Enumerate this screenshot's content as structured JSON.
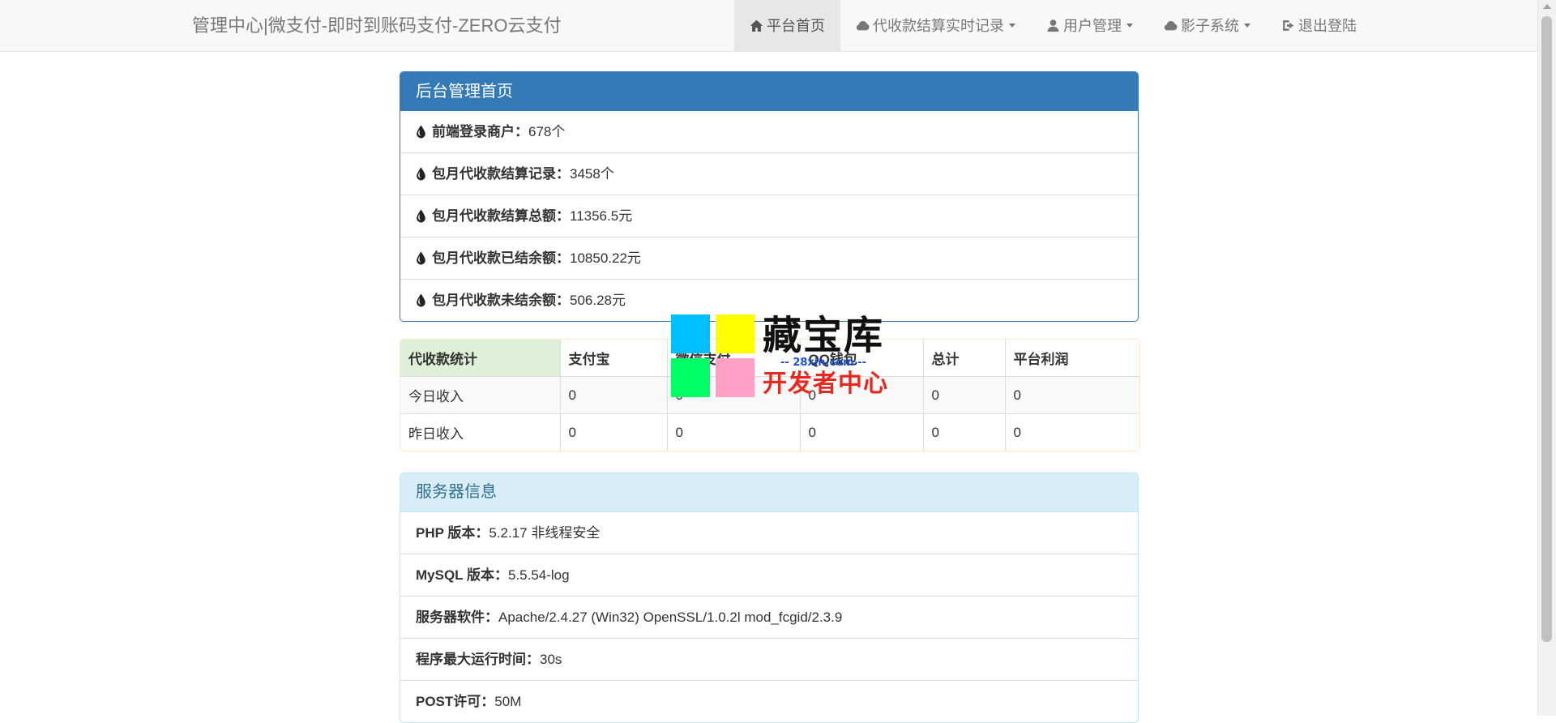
{
  "navbar": {
    "brand": "管理中心|微支付-即时到账码支付-ZERO云支付",
    "items": [
      {
        "label": "平台首页",
        "icon": "home-icon",
        "active": true
      },
      {
        "label": "代收款结算实时记录",
        "icon": "cloud-icon",
        "dropdown": true
      },
      {
        "label": "用户管理",
        "icon": "user-icon",
        "dropdown": true
      },
      {
        "label": "影子系统",
        "icon": "cloud-icon",
        "dropdown": true
      },
      {
        "label": "退出登陆",
        "icon": "logout-icon"
      }
    ]
  },
  "admin_panel": {
    "title": "后台管理首页",
    "items": [
      {
        "label": "前端登录商户：",
        "value": "678个"
      },
      {
        "label": "包月代收款结算记录：",
        "value": "3458个"
      },
      {
        "label": "包月代收款结算总额：",
        "value": "11356.5元"
      },
      {
        "label": "包月代收款已结余额：",
        "value": "10850.22元"
      },
      {
        "label": "包月代收款未结余额：",
        "value": "506.28元"
      }
    ]
  },
  "stats_table": {
    "headers": [
      "代收款统计",
      "支付宝",
      "微信支付",
      "QQ钱包",
      "总计",
      "平台利润"
    ],
    "rows": [
      [
        "今日收入",
        "0",
        "0",
        "0",
        "0",
        "0"
      ],
      [
        "昨日收入",
        "0",
        "0",
        "0",
        "0",
        "0"
      ]
    ]
  },
  "server_panel": {
    "title": "服务器信息",
    "items": [
      {
        "label": "PHP 版本：",
        "value": "5.2.17 非线程安全"
      },
      {
        "label": "MySQL 版本：",
        "value": "5.5.54-log"
      },
      {
        "label": "服务器软件：",
        "value": "Apache/2.4.27 (Win32) OpenSSL/1.0.2l mod_fcgid/2.3.9"
      },
      {
        "label": "程序最大运行时间：",
        "value": "30s"
      },
      {
        "label": "POST许可：",
        "value": "50M"
      }
    ]
  },
  "watermark": {
    "title": "藏宝库",
    "url": "-- 28xin.com --",
    "subtitle": "开发者中心",
    "colors": [
      "#00bfff",
      "#ffff00",
      "#00ff66",
      "#ffa0c8"
    ]
  },
  "colors": {
    "primary": "#337ab7",
    "info_bg": "#d9edf7",
    "info_text": "#31708f",
    "success_bg": "#dff0d8",
    "warning_border": "#faebcc"
  }
}
